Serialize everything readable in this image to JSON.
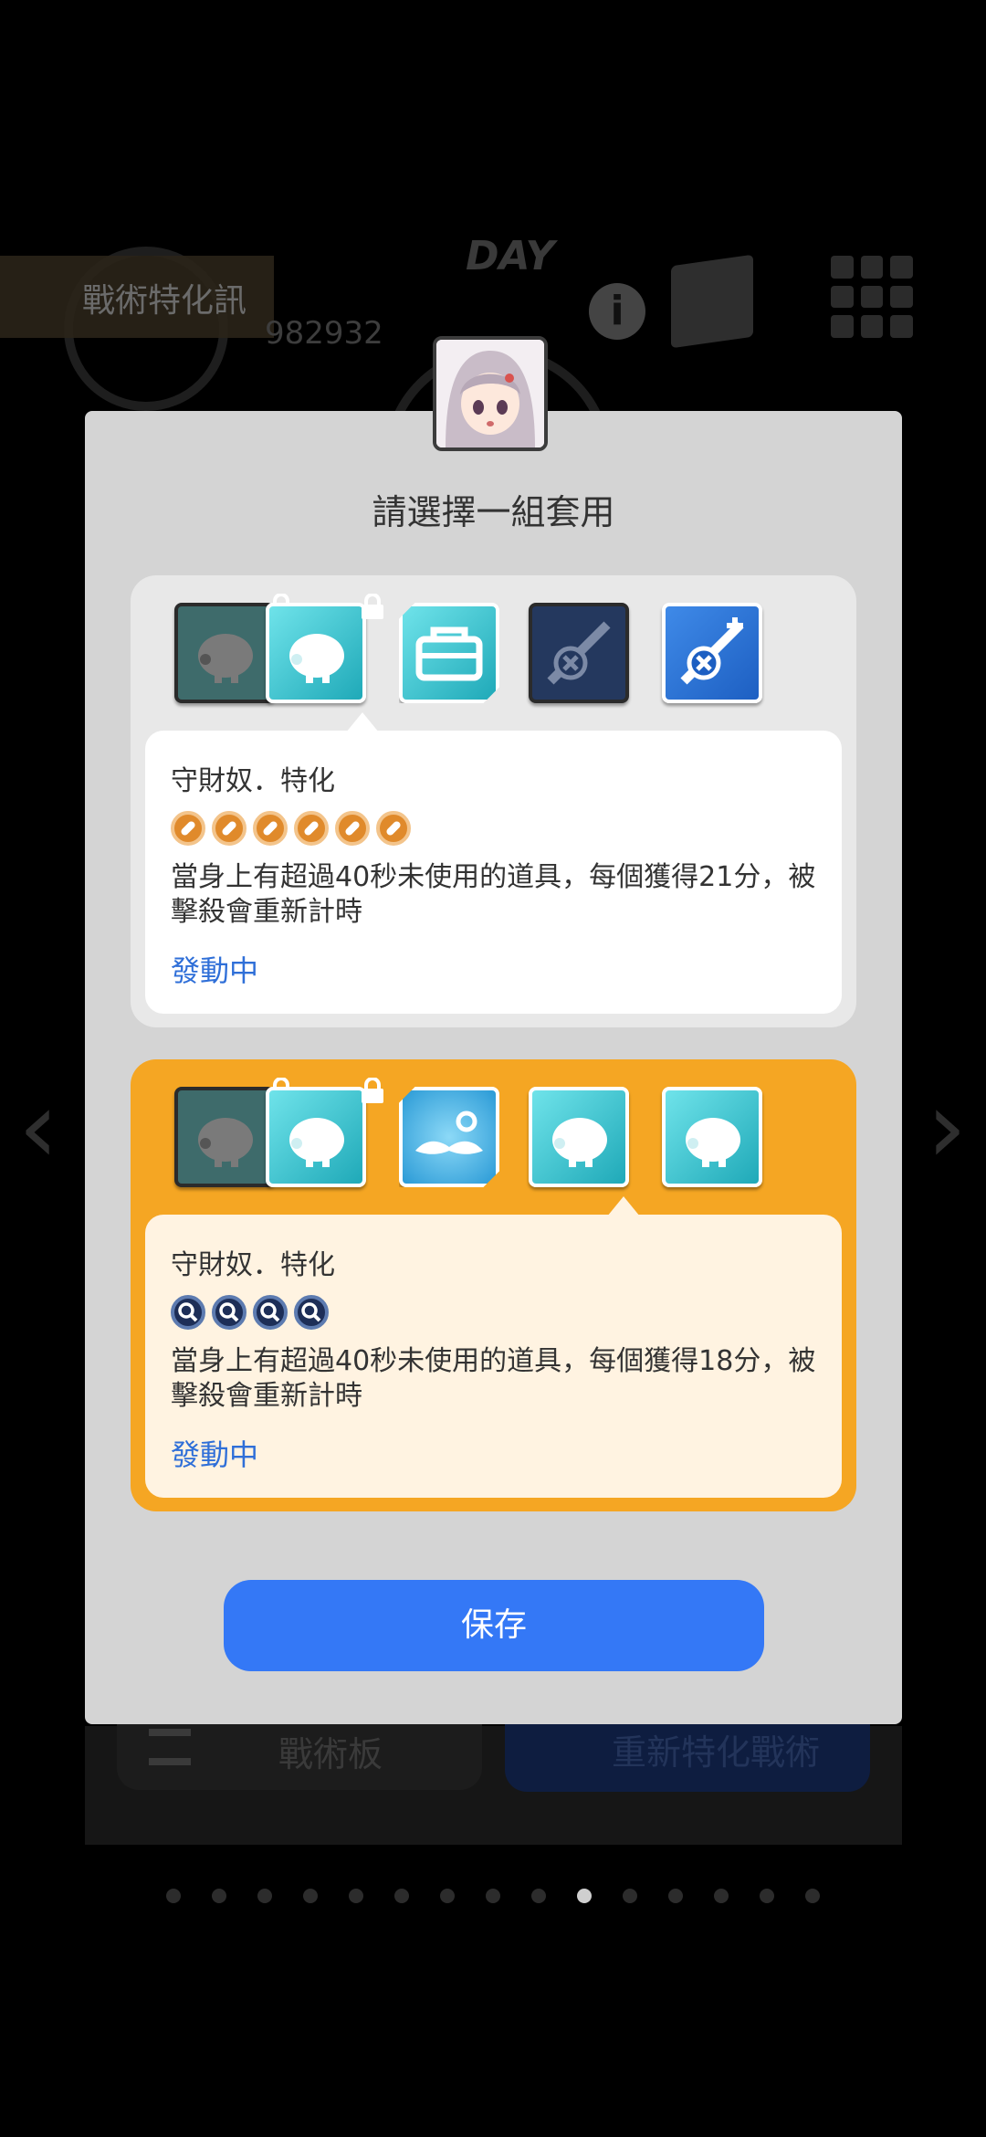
{
  "background": {
    "header_title": "戰術特化訊",
    "day_label": "DAY",
    "score_text": "982932",
    "tactics_board_label": "戰術板",
    "respec_label": "重新特化戰術",
    "page_dots_total": 15,
    "page_dots_active_index": 9
  },
  "dialog": {
    "title": "請選擇一組套用",
    "save_label": "保存",
    "sets": [
      {
        "selected": false,
        "icons": [
          "piggy-bank-locked-icon",
          "piggy-bank-icon",
          "bag-icon",
          "disabled-sword-icon",
          "sword-upgrade-icon"
        ],
        "skill_name": "守財奴．特化",
        "description": "當身上有超過40秒未使用的道具，每個獲得21分，被擊殺會重新計時",
        "status": "發動中"
      },
      {
        "selected": true,
        "icons": [
          "piggy-bank-locked-icon",
          "piggy-bank-icon",
          "mustache-icon",
          "piggy-bank-icon",
          "piggy-bank-icon"
        ],
        "skill_name": "守財奴．特化",
        "description": "當身上有超過40秒未使用的道具，每個獲得18分，被擊殺會重新計時",
        "status": "發動中"
      }
    ]
  },
  "colors": {
    "accent": "#f5a623",
    "button": "#3478f6",
    "status_text": "#2f6fd8"
  }
}
